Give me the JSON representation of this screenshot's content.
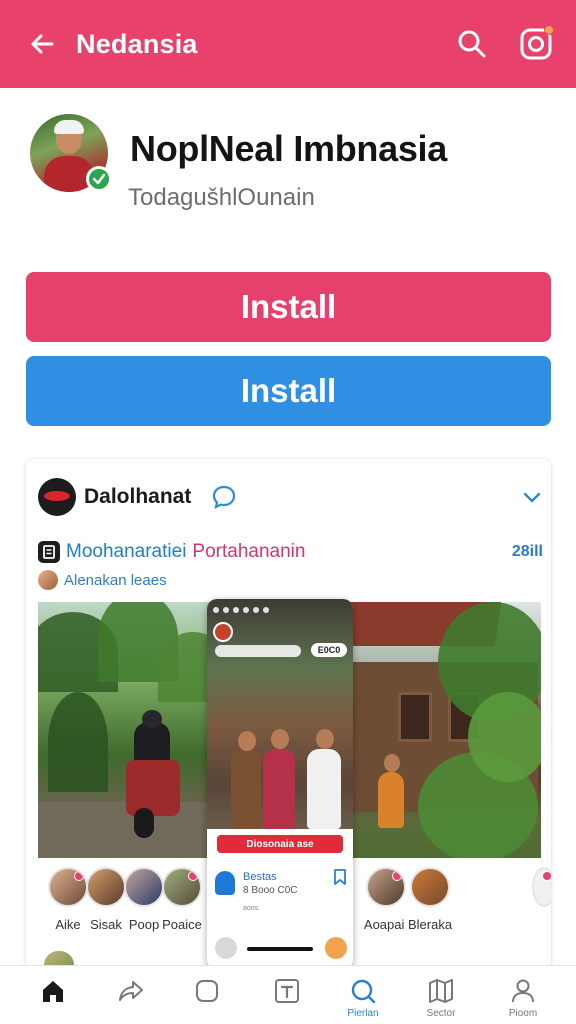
{
  "topbar": {
    "title": "Nedansia",
    "accent": "#e8416b"
  },
  "profile": {
    "name": "NoplNeal Imbnasia",
    "handle": "TodagušhlOunain"
  },
  "buttons": {
    "primary": "Install",
    "secondary": "Install",
    "primary_color": "#e6416d",
    "secondary_color": "#2f8fe2"
  },
  "card": {
    "name": "Dalolhanat",
    "subtitle_a": "Moohanaratiei",
    "subtitle_b": "Portahananin",
    "count": "28ill",
    "tag": "Alenakan leaes",
    "phone": {
      "chip": "E0C0",
      "red_label": "Diosonaia ase",
      "row_title": "Bestas",
      "row_sub": "8 Booo C0C",
      "row_meta": "aoos"
    },
    "stories": [
      {
        "label": "Aike"
      },
      {
        "label": "Sisak"
      },
      {
        "label": "Poop"
      },
      {
        "label": "Poaice"
      },
      {
        "label": "Aoapai Bleraka"
      }
    ]
  },
  "nav": [
    {
      "label": "",
      "icon": "home-icon"
    },
    {
      "label": "",
      "icon": "share-icon"
    },
    {
      "label": "",
      "icon": "square-icon"
    },
    {
      "label": "",
      "icon": "text-box-icon"
    },
    {
      "label": "Pierlan",
      "icon": "search-icon"
    },
    {
      "label": "Sector",
      "icon": "map-icon"
    },
    {
      "label": "Pioom",
      "icon": "profile-icon"
    }
  ]
}
